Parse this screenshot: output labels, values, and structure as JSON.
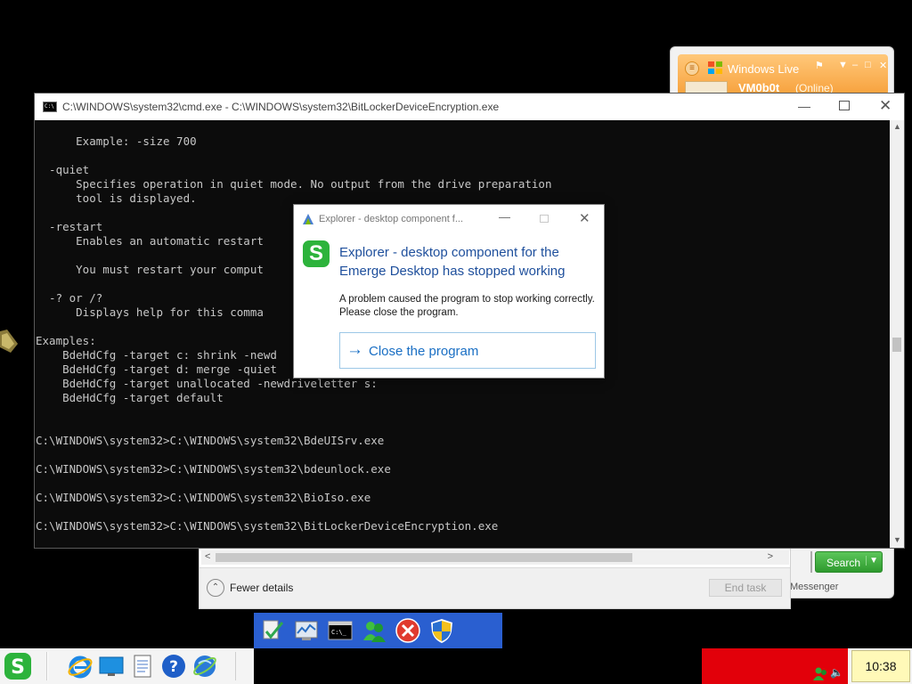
{
  "messenger": {
    "title": "Windows Live",
    "username": "VM0b0t",
    "status": "(Online)",
    "search_button": "Search",
    "footer_text": "Messenger"
  },
  "task_manager": {
    "fewer_details": "Fewer details",
    "end_task": "End task"
  },
  "cmd": {
    "title": "C:\\WINDOWS\\system32\\cmd.exe - C:\\WINDOWS\\system32\\BitLockerDeviceEncryption.exe",
    "icon_text": "C:\\",
    "lines": [
      "      Example: -size 700",
      "",
      "  -quiet",
      "      Specifies operation in quiet mode. No output from the drive preparation",
      "      tool is displayed.",
      "",
      "  -restart",
      "      Enables an automatic restart",
      "",
      "      You must restart your comput",
      "",
      "  -? or /?",
      "      Displays help for this comma",
      "",
      "Examples:",
      "    BdeHdCfg -target c: shrink -newd",
      "    BdeHdCfg -target d: merge -quiet",
      "    BdeHdCfg -target unallocated -newdriveletter s:",
      "    BdeHdCfg -target default",
      "",
      "",
      "C:\\WINDOWS\\system32>C:\\WINDOWS\\system32\\BdeUISrv.exe",
      "",
      "C:\\WINDOWS\\system32>C:\\WINDOWS\\system32\\bdeunlock.exe",
      "",
      "C:\\WINDOWS\\system32>C:\\WINDOWS\\system32\\BioIso.exe",
      "",
      "C:\\WINDOWS\\system32>C:\\WINDOWS\\system32\\BitLockerDeviceEncryption.exe"
    ]
  },
  "dialog": {
    "title": "Explorer - desktop component f...",
    "heading": "Explorer - desktop component for the Emerge Desktop has stopped working",
    "message": "A problem caused the program to stop working correctly. Please close the program.",
    "button": "Close the program"
  },
  "taskbar": {
    "clock": "10:38"
  },
  "colors": {
    "dialog_heading": "#1e4f9c",
    "dialog_button": "#1a6fc4",
    "emerge_green": "#2db33c",
    "tray_red": "#e2000a",
    "clock_bg": "#fff9b8",
    "quicklaunch_blue": "#2a5fd0",
    "messenger_orange": "#f7a13c"
  },
  "icons": {
    "cmd_window": "console-icon",
    "dialog": "emerge-icon",
    "start": "emerge-start-icon",
    "taskbar": [
      "internet-explorer-icon",
      "desktop-icon",
      "notepad-icon",
      "help-icon",
      "windows-update-icon"
    ],
    "quick_launch": [
      "check-document-icon",
      "performance-monitor-icon",
      "command-prompt-icon",
      "messenger-icon",
      "error-icon",
      "security-shield-icon"
    ],
    "tray": [
      "messenger-tray-icon",
      "volume-icon"
    ]
  }
}
